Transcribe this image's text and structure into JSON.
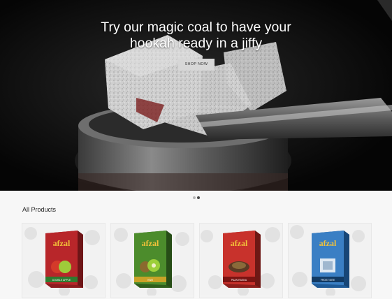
{
  "hero": {
    "title_line1": "Try our magic coal to have your",
    "title_line2": "hookah ready in a jiffy",
    "button_label": "SHOP NOW"
  },
  "carousel": {
    "slides": 2,
    "active": 2
  },
  "section": {
    "title": "All Products"
  },
  "products": [
    {
      "brand": "afzal",
      "flavor": "DOUBLE APPLE",
      "box_color": "#b8262a",
      "fruit": "apple"
    },
    {
      "brand": "afzal",
      "flavor": "KIWI",
      "box_color": "#4c8c2c",
      "fruit": "kiwi"
    },
    {
      "brand": "afzal",
      "flavor": "PAAN RASNA",
      "box_color": "#c8322c",
      "fruit": "paan"
    },
    {
      "brand": "afzal",
      "flavor": "FROST BITE",
      "box_color": "#3a7fc4",
      "fruit": "frost"
    }
  ]
}
